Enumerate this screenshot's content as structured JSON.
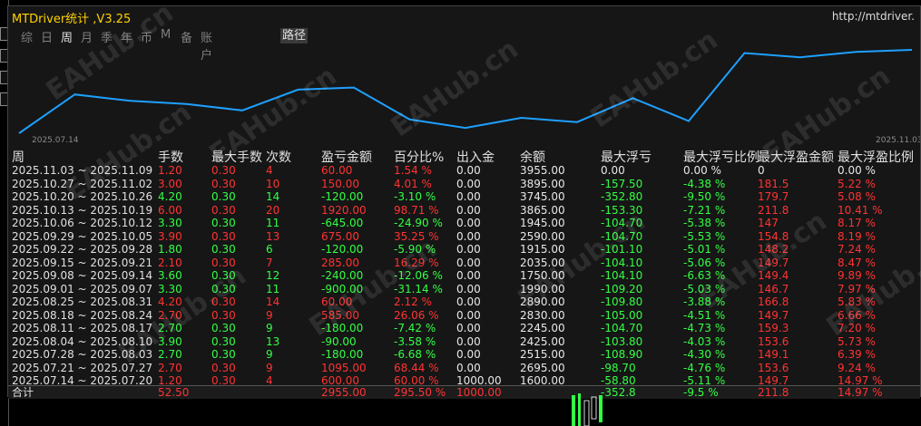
{
  "window": {
    "title": "MTDriver统计 ,V3.25",
    "url": "http://mtdriver."
  },
  "tabs": [
    {
      "label": "综",
      "active": false
    },
    {
      "label": "日",
      "active": false
    },
    {
      "label": "周",
      "active": true
    },
    {
      "label": "月",
      "active": false
    },
    {
      "label": "季",
      "active": false
    },
    {
      "label": "年",
      "active": false
    },
    {
      "label": "币",
      "active": false
    },
    {
      "label": "M",
      "active": false
    },
    {
      "label": "备",
      "active": false
    },
    {
      "label": "账户",
      "active": false
    }
  ],
  "special_button": "路径",
  "chart_data": {
    "type": "line",
    "x_start_label": "2025.07.14",
    "x_end_label": "2025.11.03",
    "x": [
      "2025.07.14",
      "2025.07.21",
      "2025.07.28",
      "2025.08.04",
      "2025.08.11",
      "2025.08.18",
      "2025.08.25",
      "2025.09.01",
      "2025.09.08",
      "2025.09.15",
      "2025.09.22",
      "2025.09.29",
      "2025.10.06",
      "2025.10.13",
      "2025.10.20",
      "2025.10.27",
      "2025.11.03"
    ],
    "values": [
      1600,
      2695,
      2515,
      2425,
      2245,
      2830,
      2890,
      1990,
      1750,
      2035,
      1915,
      2590,
      1945,
      3865,
      3745,
      3895,
      3955
    ],
    "color": "#1ea0ff",
    "grid": false
  },
  "table": {
    "headers": [
      "周",
      "手数",
      "最大手数",
      "次数",
      "盈亏金额",
      "百分比%",
      "出入金",
      "余额",
      "最大浮亏",
      "最大浮亏比例",
      "最大浮盈金额",
      "最大浮盈比例"
    ],
    "rows": [
      {
        "period": "2025.11.03 ~ 2025.11.09",
        "lots": "1.20",
        "maxlots": "0.30",
        "count": "4",
        "pnl": "60.00",
        "pct": "1.54 %",
        "flow": "0.00",
        "balance": "3955.00",
        "maxdd": "0.00",
        "maxddpct": "0.00 %",
        "maxfp": "0",
        "maxfppct": "0.00 %",
        "sign": "r"
      },
      {
        "period": "2025.10.27 ~ 2025.11.02",
        "lots": "3.00",
        "maxlots": "0.30",
        "count": "10",
        "pnl": "150.00",
        "pct": "4.01 %",
        "flow": "0.00",
        "balance": "3895.00",
        "maxdd": "-157.50",
        "maxddpct": "-4.38 %",
        "maxfp": "181.5",
        "maxfppct": "5.22 %",
        "sign": "r"
      },
      {
        "period": "2025.10.20 ~ 2025.10.26",
        "lots": "4.20",
        "maxlots": "0.30",
        "count": "14",
        "pnl": "-120.00",
        "pct": "-3.10 %",
        "flow": "0.00",
        "balance": "3745.00",
        "maxdd": "-352.80",
        "maxddpct": "-9.50 %",
        "maxfp": "179.7",
        "maxfppct": "5.08 %",
        "sign": "g"
      },
      {
        "period": "2025.10.13 ~ 2025.10.19",
        "lots": "6.00",
        "maxlots": "0.30",
        "count": "20",
        "pnl": "1920.00",
        "pct": "98.71 %",
        "flow": "0.00",
        "balance": "3865.00",
        "maxdd": "-153.30",
        "maxddpct": "-7.21 %",
        "maxfp": "211.8",
        "maxfppct": "10.41 %",
        "sign": "r"
      },
      {
        "period": "2025.10.06 ~ 2025.10.12",
        "lots": "3.30",
        "maxlots": "0.30",
        "count": "11",
        "pnl": "-645.00",
        "pct": "-24.90 %",
        "flow": "0.00",
        "balance": "1945.00",
        "maxdd": "-104.70",
        "maxddpct": "-5.38 %",
        "maxfp": "147",
        "maxfppct": "8.17 %",
        "sign": "g"
      },
      {
        "period": "2025.09.29 ~ 2025.10.05",
        "lots": "3.90",
        "maxlots": "0.30",
        "count": "13",
        "pnl": "675.00",
        "pct": "35.25 %",
        "flow": "0.00",
        "balance": "2590.00",
        "maxdd": "-104.70",
        "maxddpct": "-5.53 %",
        "maxfp": "154.8",
        "maxfppct": "8.19 %",
        "sign": "r"
      },
      {
        "period": "2025.09.22 ~ 2025.09.28",
        "lots": "1.80",
        "maxlots": "0.30",
        "count": "6",
        "pnl": "-120.00",
        "pct": "-5.90 %",
        "flow": "0.00",
        "balance": "1915.00",
        "maxdd": "-101.10",
        "maxddpct": "-5.01 %",
        "maxfp": "148.2",
        "maxfppct": "7.24 %",
        "sign": "g"
      },
      {
        "period": "2025.09.15 ~ 2025.09.21",
        "lots": "2.10",
        "maxlots": "0.30",
        "count": "7",
        "pnl": "285.00",
        "pct": "16.29 %",
        "flow": "0.00",
        "balance": "2035.00",
        "maxdd": "-104.10",
        "maxddpct": "-5.06 %",
        "maxfp": "149.7",
        "maxfppct": "8.47 %",
        "sign": "r"
      },
      {
        "period": "2025.09.08 ~ 2025.09.14",
        "lots": "3.60",
        "maxlots": "0.30",
        "count": "12",
        "pnl": "-240.00",
        "pct": "-12.06 %",
        "flow": "0.00",
        "balance": "1750.00",
        "maxdd": "-104.10",
        "maxddpct": "-6.63 %",
        "maxfp": "149.4",
        "maxfppct": "9.89 %",
        "sign": "g"
      },
      {
        "period": "2025.09.01 ~ 2025.09.07",
        "lots": "3.30",
        "maxlots": "0.30",
        "count": "11",
        "pnl": "-900.00",
        "pct": "-31.14 %",
        "flow": "0.00",
        "balance": "1990.00",
        "maxdd": "-109.20",
        "maxddpct": "-5.03 %",
        "maxfp": "146.7",
        "maxfppct": "7.97 %",
        "sign": "g"
      },
      {
        "period": "2025.08.25 ~ 2025.08.31",
        "lots": "4.20",
        "maxlots": "0.30",
        "count": "14",
        "pnl": "60.00",
        "pct": "2.12 %",
        "flow": "0.00",
        "balance": "2890.00",
        "maxdd": "-109.80",
        "maxddpct": "-3.88 %",
        "maxfp": "166.8",
        "maxfppct": "5.83 %",
        "sign": "r"
      },
      {
        "period": "2025.08.18 ~ 2025.08.24",
        "lots": "2.70",
        "maxlots": "0.30",
        "count": "9",
        "pnl": "585.00",
        "pct": "26.06 %",
        "flow": "0.00",
        "balance": "2830.00",
        "maxdd": "-105.00",
        "maxddpct": "-4.51 %",
        "maxfp": "149.7",
        "maxfppct": "6.66 %",
        "sign": "r"
      },
      {
        "period": "2025.08.11 ~ 2025.08.17",
        "lots": "2.70",
        "maxlots": "0.30",
        "count": "9",
        "pnl": "-180.00",
        "pct": "-7.42 %",
        "flow": "0.00",
        "balance": "2245.00",
        "maxdd": "-104.70",
        "maxddpct": "-4.73 %",
        "maxfp": "159.3",
        "maxfppct": "7.20 %",
        "sign": "g"
      },
      {
        "period": "2025.08.04 ~ 2025.08.10",
        "lots": "3.90",
        "maxlots": "0.30",
        "count": "13",
        "pnl": "-90.00",
        "pct": "-3.58 %",
        "flow": "0.00",
        "balance": "2425.00",
        "maxdd": "-103.80",
        "maxddpct": "-4.03 %",
        "maxfp": "153.6",
        "maxfppct": "5.73 %",
        "sign": "g"
      },
      {
        "period": "2025.07.28 ~ 2025.08.03",
        "lots": "2.70",
        "maxlots": "0.30",
        "count": "9",
        "pnl": "-180.00",
        "pct": "-6.68 %",
        "flow": "0.00",
        "balance": "2515.00",
        "maxdd": "-108.90",
        "maxddpct": "-4.30 %",
        "maxfp": "149.1",
        "maxfppct": "6.39 %",
        "sign": "g"
      },
      {
        "period": "2025.07.21 ~ 2025.07.27",
        "lots": "2.70",
        "maxlots": "0.30",
        "count": "9",
        "pnl": "1095.00",
        "pct": "68.44 %",
        "flow": "0.00",
        "balance": "2695.00",
        "maxdd": "-98.70",
        "maxddpct": "-4.76 %",
        "maxfp": "153.6",
        "maxfppct": "9.24 %",
        "sign": "r"
      },
      {
        "period": "2025.07.14 ~ 2025.07.20",
        "lots": "1.20",
        "maxlots": "0.30",
        "count": "4",
        "pnl": "600.00",
        "pct": "60.00 %",
        "flow": "1000.00",
        "balance": "1600.00",
        "maxdd": "-58.80",
        "maxddpct": "-5.11 %",
        "maxfp": "149.7",
        "maxfppct": "14.97 %",
        "sign": "r"
      }
    ],
    "total": {
      "label": "合计",
      "lots": "52.50",
      "pnl": "2955.00",
      "pct": "295.50 %",
      "flow": "1000.00",
      "maxdd": "-352.8",
      "maxddpct": "-9.5 %",
      "maxfp": "211.8",
      "maxfppct": "14.97 %"
    }
  },
  "watermark": "EAHub.cn"
}
